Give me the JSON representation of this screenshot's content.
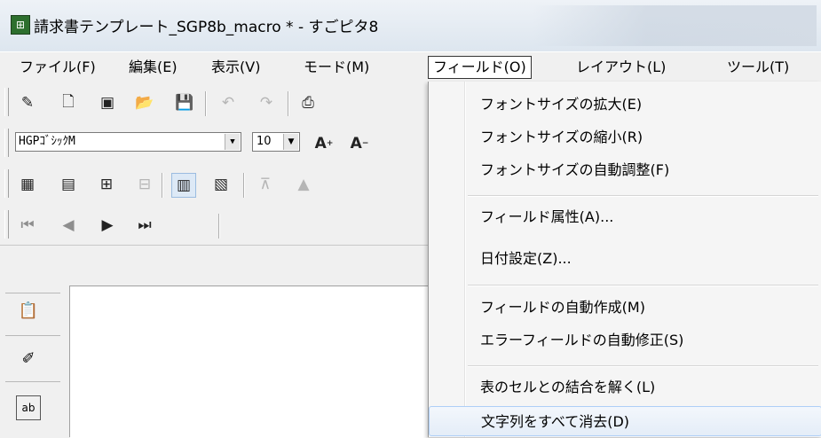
{
  "window": {
    "app_icon": "app-icon",
    "title": "請求書テンプレート_SGP8b_macro * - すごピタ8"
  },
  "menubar": [
    {
      "label": "ファイル(F)"
    },
    {
      "label": "編集(E)"
    },
    {
      "label": "表示(V)"
    },
    {
      "label": "モード(M)"
    },
    {
      "label": "フィールド(O)",
      "active": true
    },
    {
      "label": "レイアウト(L)"
    },
    {
      "label": "ツール(T)"
    }
  ],
  "toolbar_std": {
    "icons": [
      "pen-icon",
      "new-document-icon",
      "pdf-icon",
      "open-folder-icon",
      "save-icon",
      "undo-icon",
      "redo-icon",
      "print-icon"
    ]
  },
  "toolbar_font": {
    "font_value": "HGPｺﾞｼｯｸM",
    "size_value": "10",
    "grow_font_label": "A",
    "shrink_font_label": "A"
  },
  "toolbar_field": {
    "icons": [
      "field-grid-icon",
      "field-table-icon",
      "field-insert-icon",
      "field-copy-icon",
      "field-view-icon",
      "field-layout-icon",
      "align-top-icon",
      "move-up-icon"
    ]
  },
  "toolbar_nav": {
    "icons": [
      "first-page-icon",
      "prev-page-icon",
      "next-page-icon",
      "last-page-icon"
    ]
  },
  "left_tools": {
    "icons": [
      "clipboard-icon",
      "edit-field-icon",
      "text-field-icon"
    ]
  },
  "field_menu": {
    "items": [
      "フォントサイズの拡大(E)",
      "フォントサイズの縮小(R)",
      "フォントサイズの自動調整(F)",
      "フィールド属性(A)...",
      "日付設定(Z)...",
      "フィールドの自動作成(M)",
      "エラーフィールドの自動修正(S)",
      "表のセルとの結合を解く(L)",
      "文字列をすべて消去(D)"
    ],
    "highlighted_index": 8
  },
  "colors": {
    "highlight": "#e4edf8",
    "menu_active_border": "#333333"
  }
}
